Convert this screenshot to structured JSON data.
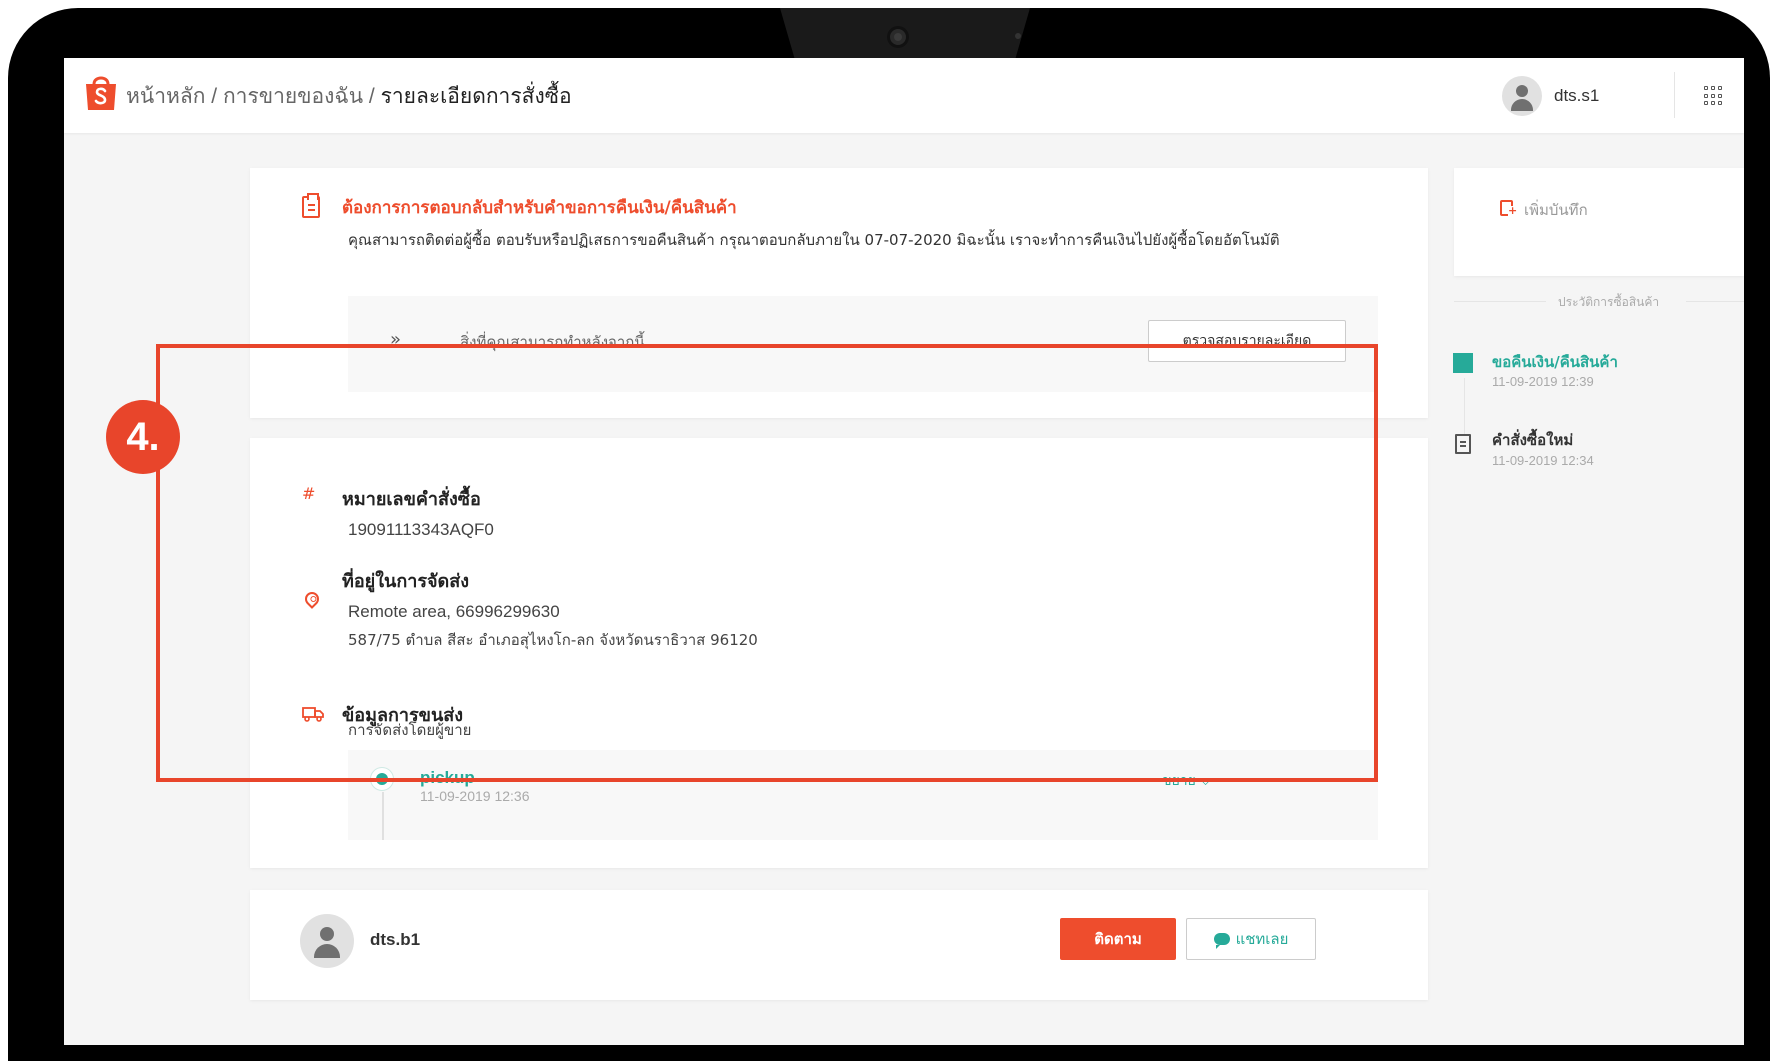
{
  "colors": {
    "brand": "#ee4d2d",
    "accent": "#26aa99",
    "highlight": "#e8452b"
  },
  "header": {
    "crumb_home": "หน้าหลัก",
    "crumb_sep1": " / ",
    "crumb_sales": "การขายของฉัน",
    "crumb_sep2": " / ",
    "crumb_current": "รายละเอียดการสั่งซื้อ",
    "username": "dts.s1",
    "apps_icon": "apps-grid-icon"
  },
  "alert": {
    "title": "ต้องการการตอบกลับสำหรับคำขอการคืนเงิน/คืนสินค้า",
    "description": "คุณสามารถติดต่อผู้ซื้อ ตอบรับหรือปฏิเสธการขอคืนสินค้า กรุณาตอบกลับภายใน 07-07-2020 มิฉะนั้น เราจะทำการคืนเงินไปยังผู้ซื้อโดยอัตโนมัติ",
    "next_label": "สิ่งที่คุณสามารถทำหลังจากนี้",
    "next_icon": "»",
    "check_button": "ตรวจสอบรายละเอียด"
  },
  "order": {
    "id_title": "หมายเลขคำสั่งซื้อ",
    "id_icon": "#",
    "id_value": "19091113343AQF0",
    "address_title": "ที่อยู่ในการจัดส่ง",
    "address_line1": "Remote area, 66996299630",
    "address_line2": "587/75 ตำบล สีสะ อำเภอสุไหงโก-ลก จังหวัดนราธิวาส 96120",
    "shipping_title": "ข้อมูลการขนส่ง",
    "shipping_method": "การจัดส่งโดยผู้ขาย",
    "tracking": {
      "status": "pickup",
      "time": "11-09-2019 12:36",
      "expand_label": "ขยาย ⌵"
    }
  },
  "step_badge": "4.",
  "buyer": {
    "name": "dts.b1",
    "follow_button": "ติดตาม",
    "chat_button": "แชทเลย"
  },
  "sidebar": {
    "add_note": "เพิ่มบันทึก",
    "history_title": "ประวัติการซื้อสินค้า",
    "events": [
      {
        "title": "ขอคืนเงิน/คืนสินค้า",
        "time": "11-09-2019 12:39"
      },
      {
        "title": "คำสั่งซื้อใหม่",
        "time": "11-09-2019 12:34"
      }
    ]
  }
}
